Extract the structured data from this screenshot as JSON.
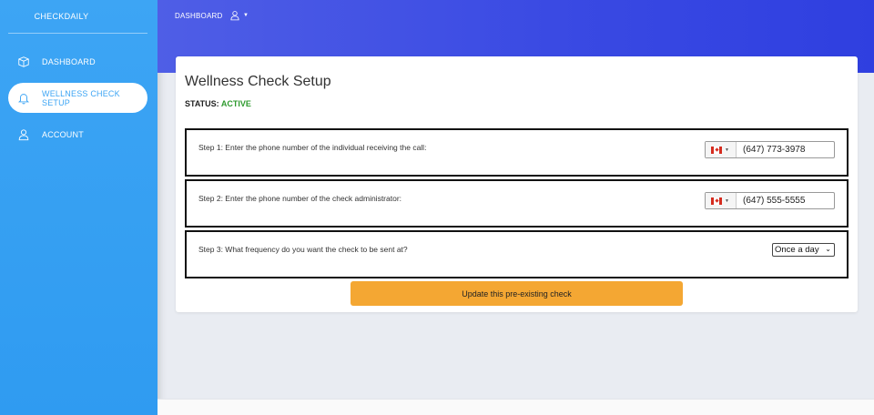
{
  "sidebar": {
    "brand": "CHECKDAILY",
    "items": [
      {
        "label": "DASHBOARD",
        "icon": "box-icon"
      },
      {
        "label": "WELLNESS CHECK SETUP",
        "icon": "bell-icon",
        "active": true
      },
      {
        "label": "ACCOUNT",
        "icon": "user-icon"
      }
    ]
  },
  "topbar": {
    "link": "DASHBOARD",
    "user_icon": "user-icon"
  },
  "card": {
    "title": "Wellness Check Setup",
    "status_label": "STATUS:",
    "status_value": "ACTIVE",
    "steps": [
      {
        "text": "Step 1: Enter the phone number of the individual receiving the call:",
        "country": "CA",
        "phone": "(647) 773-3978"
      },
      {
        "text": "Step 2: Enter the phone number of the check administrator:",
        "country": "CA",
        "phone": "(647) 555-5555"
      },
      {
        "text": "Step 3: What frequency do you want the check to be sent at?",
        "selected_option": "Once a day"
      }
    ],
    "button_label": "Update this pre-existing check"
  },
  "colors": {
    "sidebar": "#3da5f4",
    "topbar": "#3a4ae3",
    "status_active": "#2e9a2e",
    "button": "#f4a733"
  }
}
